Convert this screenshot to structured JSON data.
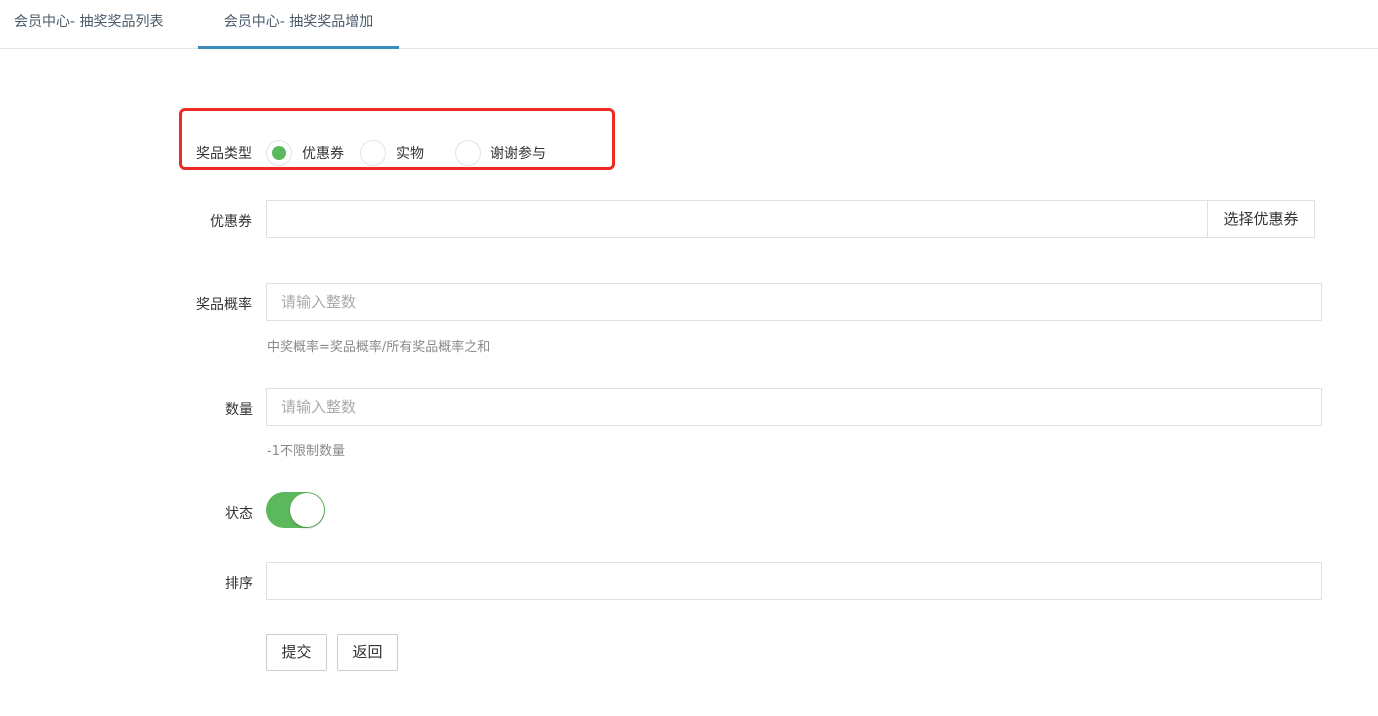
{
  "tabs": [
    {
      "label": "会员中心- 抽奖奖品列表",
      "active": false
    },
    {
      "label": "会员中心- 抽奖奖品增加",
      "active": true
    }
  ],
  "prize_type": {
    "label": "奖品类型",
    "options": [
      "优惠券",
      "实物",
      "谢谢参与"
    ],
    "selected": "优惠券"
  },
  "coupon": {
    "label": "优惠券",
    "value": "",
    "button_label": "选择优惠券"
  },
  "probability": {
    "label": "奖品概率",
    "placeholder": "请输入整数",
    "help": "中奖概率=奖品概率/所有奖品概率之和"
  },
  "quantity": {
    "label": "数量",
    "placeholder": "请输入整数",
    "help": "-1不限制数量"
  },
  "status": {
    "label": "状态",
    "enabled": true
  },
  "sort": {
    "label": "排序",
    "value": ""
  },
  "actions": {
    "submit_label": "提交",
    "back_label": "返回"
  },
  "colors": {
    "accent": "#3c8dbc",
    "success": "#5cb85c",
    "highlight": "#ee2a24"
  }
}
